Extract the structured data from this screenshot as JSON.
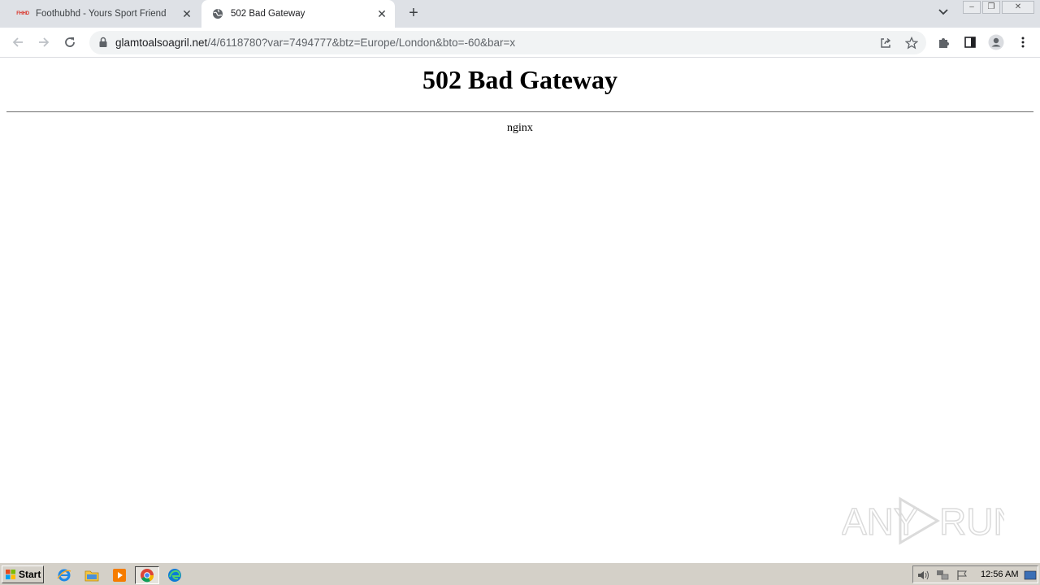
{
  "browser": {
    "tabs": [
      {
        "title": "Foothubhd - Yours Sport Friend",
        "favicon": "foothubhd-logo-icon",
        "active": false
      },
      {
        "title": "502 Bad Gateway",
        "favicon": "globe-icon",
        "active": true
      }
    ],
    "url_host": "glamtoalsoagril.net",
    "url_rest": "/4/6118780?var=7494777&btz=Europe/London&bto=-60&bar=x",
    "tab1_logo_text": "FHHD"
  },
  "page": {
    "heading": "502 Bad Gateway",
    "server": "nginx"
  },
  "watermark": {
    "text_left": "ANY",
    "text_right": "RUN"
  },
  "taskbar": {
    "start_label": "Start",
    "clock": "12:56 AM"
  }
}
